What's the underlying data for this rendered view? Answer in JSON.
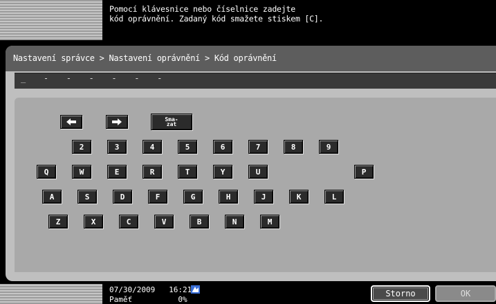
{
  "header": {
    "message_line1": "Pomocí klávesnice nebo číselnice zadejte",
    "message_line2": "kód oprávnění. Zadaný kód smažete stiskem [C]."
  },
  "breadcrumb": "Nastavení správce > Nastavení oprávnění > Kód oprávnění",
  "code_field": {
    "value": "_ - - - - - -"
  },
  "keypad": {
    "clear_label": "Sma-\nzat",
    "digits": [
      "2",
      "3",
      "4",
      "5",
      "6",
      "7",
      "8",
      "9"
    ],
    "row_q": [
      "Q",
      "W",
      "E",
      "R",
      "T",
      "Y",
      "U",
      "P"
    ],
    "row_a": [
      "A",
      "S",
      "D",
      "F",
      "G",
      "H",
      "J",
      "K",
      "L"
    ],
    "row_z": [
      "Z",
      "X",
      "C",
      "V",
      "B",
      "N",
      "M"
    ],
    "icons": {
      "left": "arrow-left-icon",
      "right": "arrow-right-icon"
    }
  },
  "footer": {
    "datetime": "07/30/2009   16:21",
    "memory": "Paměť          0%",
    "storno_label": "Storno",
    "ok_label": "OK",
    "status_icon": "network-status-icon"
  },
  "colors": {
    "panel": "#bfbfbf",
    "keypad_bg": "#a9a9a9",
    "key": "#2b2b2b",
    "crumbbar": "#5d5d5d"
  }
}
